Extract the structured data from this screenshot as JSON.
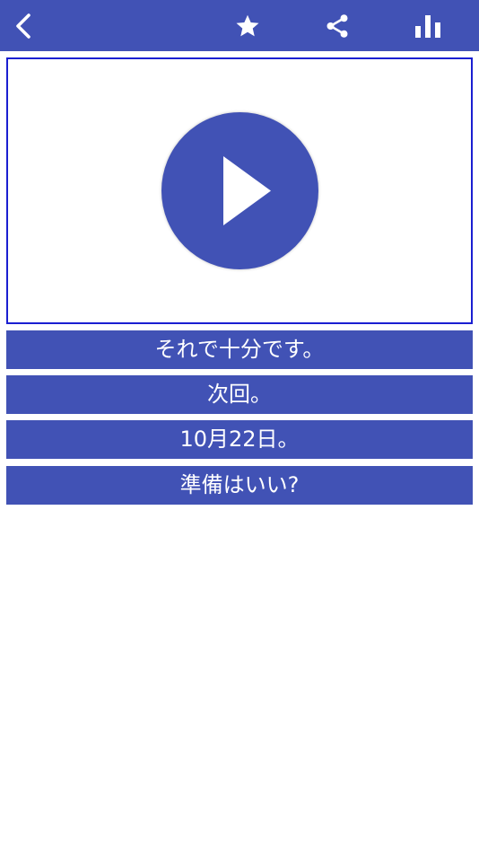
{
  "colors": {
    "primary": "#4152b5",
    "video_border": "#1a1fd1",
    "background": "#ffffff",
    "text_on_primary": "#ffffff"
  },
  "toolbar": {
    "icons": [
      "back-chevron-icon",
      "star-icon",
      "share-icon",
      "bar-chart-icon"
    ]
  },
  "video": {
    "icon": "play-icon"
  },
  "phrases": [
    "それで十分です。",
    "次回。",
    "10月22日。",
    "準備はいい?"
  ]
}
